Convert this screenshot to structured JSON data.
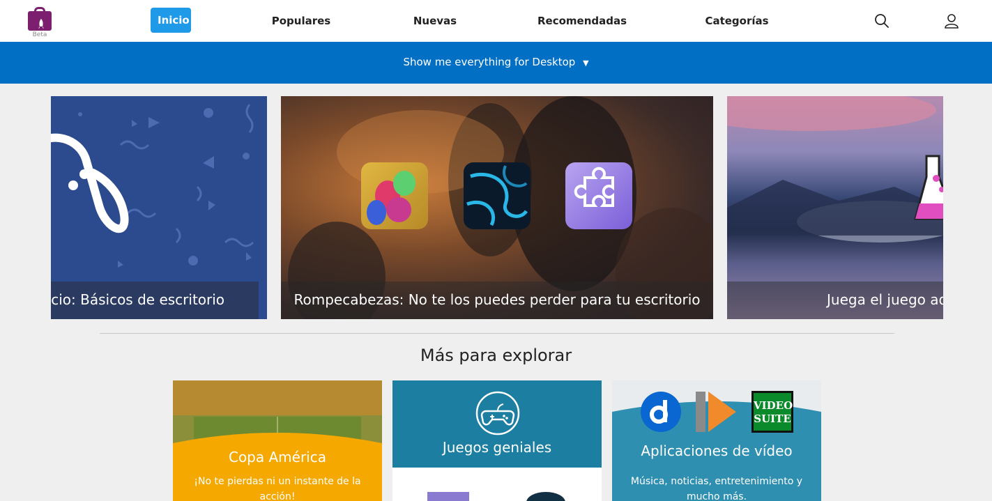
{
  "header": {
    "logo_beta": "Beta",
    "nav": [
      "Inicio",
      "Populares",
      "Nuevas",
      "Recomendadas",
      "Categorías"
    ],
    "active_nav": "Inicio",
    "icons": [
      "search-icon",
      "user-icon"
    ]
  },
  "filter_bar": {
    "label": "Show me everything for Desktop",
    "arrow": "▼"
  },
  "carousel": {
    "slides": [
      {
        "caption": "ocio: Básicos de escritorio",
        "icon": "gamepad-icon",
        "color": "#2c4a8e"
      },
      {
        "caption": "Rompecabezas: No te los puedes perder para tu escritorio",
        "apps": [
          "marble-game-app",
          "spiral-app",
          "puzzle-app"
        ]
      },
      {
        "caption": "Juega el juego adic",
        "icon": "flask-icon"
      }
    ]
  },
  "explore": {
    "title": "Más para explorar",
    "cards": [
      {
        "title": "Copa América",
        "desc": "¡No te pierdas ni un instante de la acción!",
        "color": "#f5a800"
      },
      {
        "title": "Juegos geniales",
        "desc": "",
        "color": "#1c7ea0",
        "icon": "gamepad-icon"
      },
      {
        "title": "Aplicaciones de vídeo",
        "desc": "Música, noticias, entretenimiento y mucho más.",
        "color": "#2e8fb0",
        "apps": [
          "dailymotion-app",
          "player-app",
          "video-suite-app"
        ],
        "video_suite_label": "VIDEO SUITE"
      }
    ]
  },
  "colors": {
    "accent": "#1e9ae8",
    "bar": "#006fc4",
    "brand": "#7c1f6e"
  }
}
